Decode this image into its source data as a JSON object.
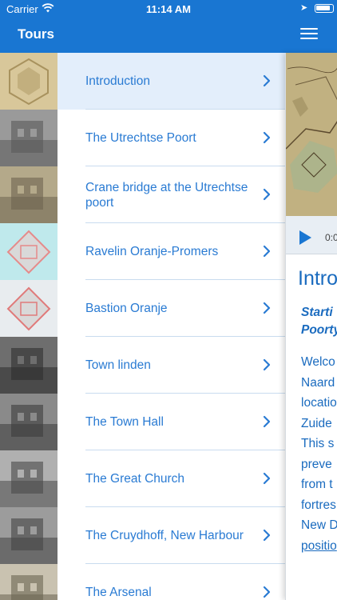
{
  "status_bar": {
    "carrier": "Carrier",
    "time": "11:14 AM"
  },
  "nav": {
    "title": "Tours"
  },
  "tours": [
    {
      "label": "Introduction",
      "selected": true
    },
    {
      "label": "The Utrechtse Poort"
    },
    {
      "label": "Crane bridge at the Utrechtse poort"
    },
    {
      "label": "Ravelin Oranje-Promers"
    },
    {
      "label": "Bastion Oranje"
    },
    {
      "label": "Town linden"
    },
    {
      "label": "The Town Hall"
    },
    {
      "label": "The Great Church"
    },
    {
      "label": "The Cruydhoff, New Harbour"
    },
    {
      "label": "The Arsenal"
    }
  ],
  "detail": {
    "player_time": "0:0",
    "title": "Intro",
    "subtitle_lines": [
      "Starti",
      "Poorty"
    ],
    "body_lines": [
      "Welco",
      "Naard",
      "locatio",
      "Zuide",
      "This s",
      "preve",
      "from t",
      "fortres",
      "New D",
      "positio"
    ]
  },
  "colors": {
    "header": "#1976d2",
    "link": "#2a7bd3",
    "selected_row": "#e3eefb"
  }
}
